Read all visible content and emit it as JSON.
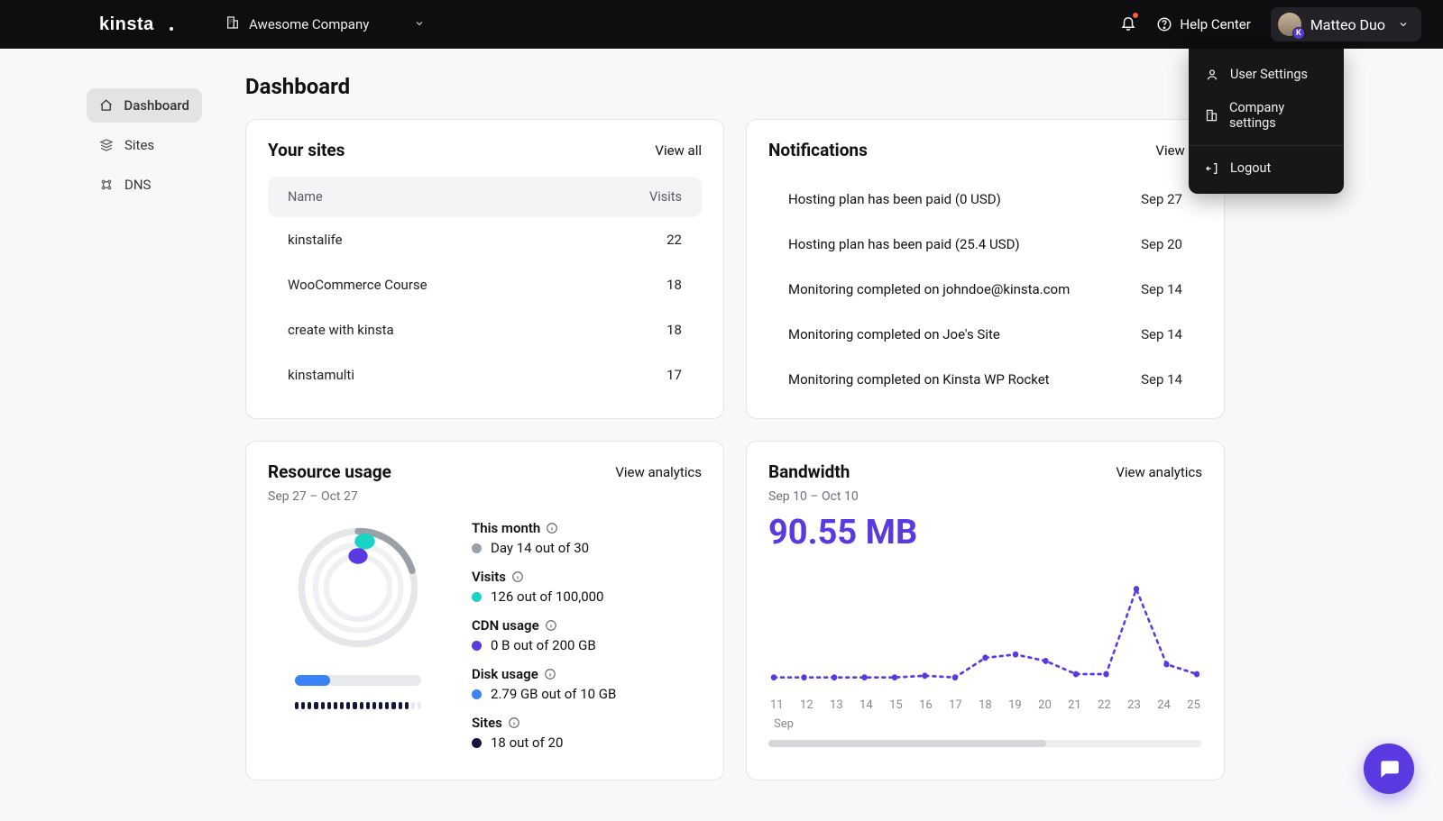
{
  "brand": "kinsta",
  "header": {
    "company": "Awesome Company",
    "help_center": "Help Center",
    "user_name": "Matteo Duo",
    "avatar_badge": "K"
  },
  "user_menu": {
    "user_settings": "User Settings",
    "company_settings": "Company settings",
    "logout": "Logout"
  },
  "sidebar": {
    "items": [
      {
        "label": "Dashboard",
        "icon": "home",
        "active": true
      },
      {
        "label": "Sites",
        "icon": "stack",
        "active": false
      },
      {
        "label": "DNS",
        "icon": "dns",
        "active": false
      }
    ]
  },
  "page_title": "Dashboard",
  "sites_card": {
    "title": "Your sites",
    "view_all": "View all",
    "col_name": "Name",
    "col_visits": "Visits",
    "rows": [
      {
        "name": "kinstalife",
        "visits": "22"
      },
      {
        "name": "WooCommerce Course",
        "visits": "18"
      },
      {
        "name": "create with kinsta",
        "visits": "18"
      },
      {
        "name": "kinstamulti",
        "visits": "17"
      }
    ]
  },
  "notifications_card": {
    "title": "Notifications",
    "view_all": "View all",
    "rows": [
      {
        "text": "Hosting plan has been paid (0 USD)",
        "date": "Sep 27"
      },
      {
        "text": "Hosting plan has been paid (25.4 USD)",
        "date": "Sep 20"
      },
      {
        "text": "Monitoring completed on johndoe@kinsta.com",
        "date": "Sep 14"
      },
      {
        "text": "Monitoring completed on Joe's Site",
        "date": "Sep 14"
      },
      {
        "text": "Monitoring completed on Kinsta WP Rocket",
        "date": "Sep 14"
      }
    ]
  },
  "resource_card": {
    "title": "Resource usage",
    "view_analytics": "View analytics",
    "range": "Sep 27 – Oct 27",
    "this_month_label": "This month",
    "this_month_value": "Day 14 out of 30",
    "visits_label": "Visits",
    "visits_value": "126 out of 100,000",
    "cdn_label": "CDN usage",
    "cdn_value": "0 B out of 200 GB",
    "disk_label": "Disk usage",
    "disk_value": "2.79 GB out of 10 GB",
    "sites_label": "Sites",
    "sites_value": "18 out of 20",
    "colors": {
      "month": "#9aa0a8",
      "visits": "#19d3c5",
      "cdn": "#5a3ae0",
      "disk": "#3b82f6",
      "sites": "#14153a"
    }
  },
  "bandwidth_card": {
    "title": "Bandwidth",
    "view_analytics": "View analytics",
    "range": "Sep 10 – Oct 10",
    "value": "90.55 MB",
    "month_label": "Sep"
  },
  "chart_data": {
    "type": "line",
    "title": "Bandwidth",
    "xlabel": "Sep",
    "ylabel": "",
    "x": [
      11,
      12,
      13,
      14,
      15,
      16,
      17,
      18,
      19,
      20,
      21,
      22,
      23,
      24,
      25
    ],
    "values": [
      6,
      6,
      6,
      6,
      6,
      7,
      6,
      18,
      20,
      16,
      8,
      8,
      60,
      14,
      8
    ],
    "ylim": [
      0,
      70
    ],
    "color": "#5a3ae0"
  }
}
